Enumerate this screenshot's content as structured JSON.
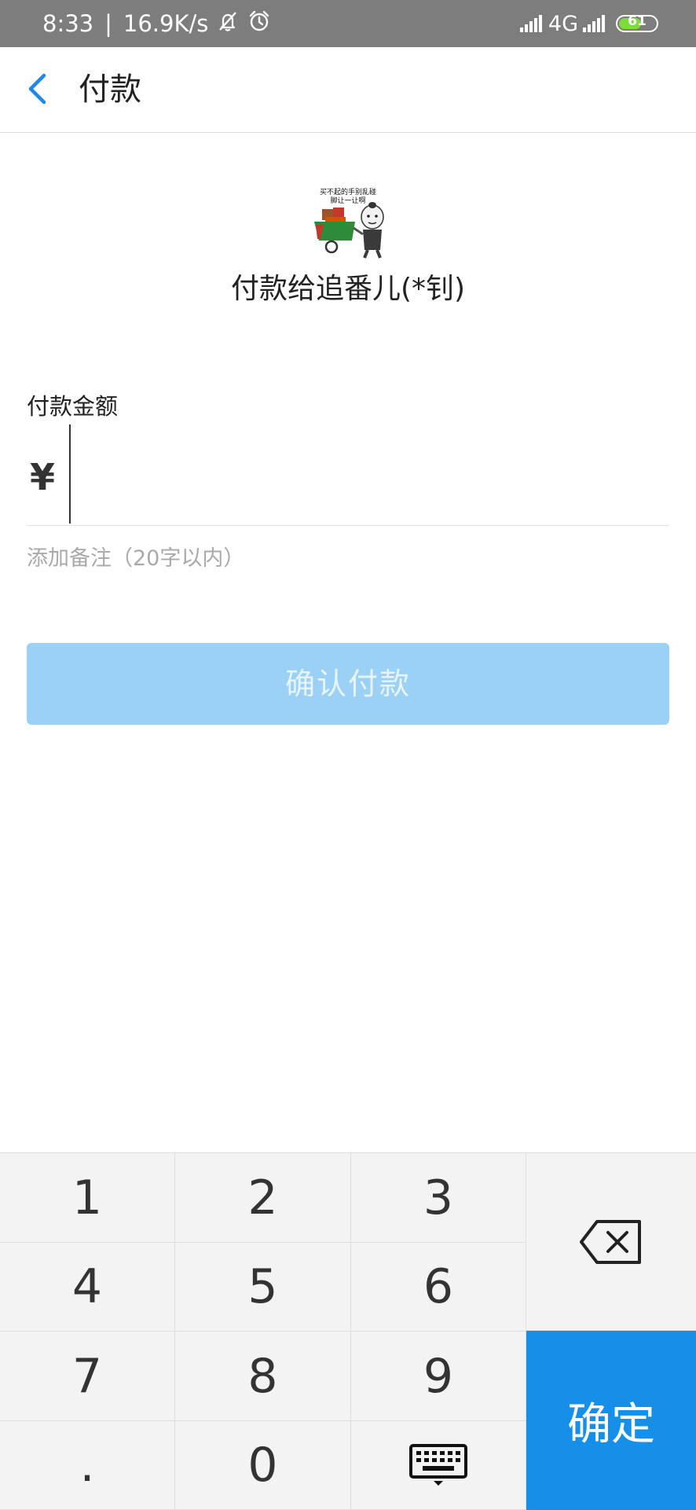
{
  "status_bar": {
    "time": "8:33",
    "separator": "|",
    "net_speed": "16.9K/s",
    "network_type": "4G",
    "battery_level": "61",
    "battery_fraction": 0.61
  },
  "header": {
    "title": "付款"
  },
  "payee": {
    "name": "付款给追番儿(*钊)",
    "avatar_caption_line1": "买不起的手别乱碰",
    "avatar_caption_line2": "脚让一让啊"
  },
  "amount": {
    "label": "付款金额",
    "currency_symbol": "¥",
    "value": "",
    "note_placeholder": "添加备注（20字以内）"
  },
  "confirm_button": {
    "label": "确认付款"
  },
  "keypad": {
    "keys": [
      "1",
      "2",
      "3",
      "4",
      "5",
      "6",
      "7",
      "8",
      "9",
      ".",
      "0"
    ],
    "ok_label": "确定"
  },
  "colors": {
    "accent": "#158fe7",
    "button_disabled": "#9bd1f4",
    "status_bar": "#7d7d7d",
    "back_arrow": "#1e88e5"
  }
}
